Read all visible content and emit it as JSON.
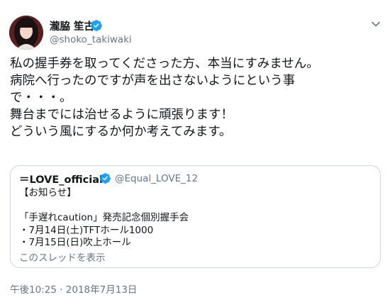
{
  "author": {
    "display_name": "瀧脇 笙古",
    "handle": "@shoko_takiwaki",
    "avatar_icon": "profile-photo",
    "verified_icon": "verified-badge-icon"
  },
  "menu_icon": "chevron-down-icon",
  "tweet": {
    "text": "私の握手券を取ってくださった方、本当にすみません。\n病院へ行ったのですが声を出さないようにという事\nで・・・。\n舞台までには治せるように頑張ります！\nどういう風にするか何か考えてみます。"
  },
  "quoted_tweet": {
    "display_name": "＝LOVE_official",
    "handle": "@Equal_LOVE_12",
    "text": "【お知らせ】\n\n「手遅れcaution」発売記念個別握手会\n・7月14日(土)TFTホール1000\n・7月15日(日)吹上ホール",
    "thread_link": "このスレッドを表示"
  },
  "timestamp": "午後10:25 · 2018年7月13日",
  "colors": {
    "text": "#14171a",
    "secondary": "#657786",
    "verified": "#1da1f2",
    "border": "#ccd6dd"
  }
}
